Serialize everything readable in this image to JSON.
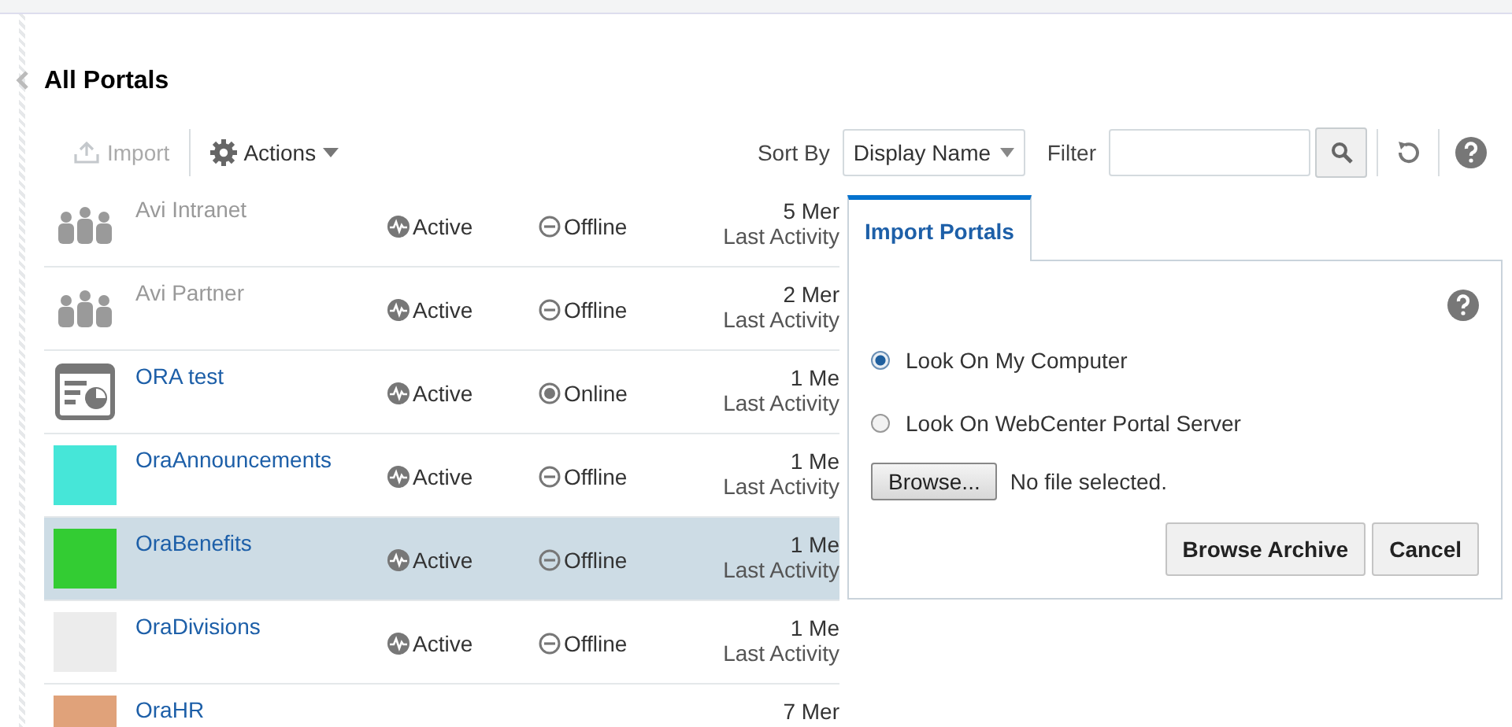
{
  "title": "All Portals",
  "toolbar": {
    "import_label": "Import",
    "import_disabled": true,
    "actions_label": "Actions",
    "sort_label": "Sort By",
    "sort_value": "Display Name",
    "filter_label": "Filter"
  },
  "portals": [
    {
      "name": "Avi Intranet",
      "thumb": {
        "kind": "people"
      },
      "disabled": true,
      "status": "Active",
      "availability": {
        "label": "Offline",
        "online": false
      },
      "date": "5 Mer",
      "activity": "Last Activity",
      "selected": false
    },
    {
      "name": "Avi Partner",
      "thumb": {
        "kind": "people"
      },
      "disabled": true,
      "status": "Active",
      "availability": {
        "label": "Offline",
        "online": false
      },
      "date": "2 Mer",
      "activity": "Last Activity",
      "selected": false
    },
    {
      "name": "ORA test",
      "thumb": {
        "kind": "page"
      },
      "disabled": false,
      "status": "Active",
      "availability": {
        "label": "Online",
        "online": true
      },
      "date": "1 Me",
      "activity": "Last Activity",
      "selected": false
    },
    {
      "name": "OraAnnouncements",
      "thumb": {
        "kind": "swatch",
        "color": "#46e6d8"
      },
      "disabled": false,
      "status": "Active",
      "availability": {
        "label": "Offline",
        "online": false
      },
      "date": "1 Me",
      "activity": "Last Activity",
      "selected": false
    },
    {
      "name": "OraBenefits",
      "thumb": {
        "kind": "swatch",
        "color": "#33cc33"
      },
      "disabled": false,
      "status": "Active",
      "availability": {
        "label": "Offline",
        "online": false
      },
      "date": "1 Me",
      "activity": "Last Activity",
      "selected": true
    },
    {
      "name": "OraDivisions",
      "thumb": {
        "kind": "swatch",
        "color": "#ececec"
      },
      "disabled": false,
      "status": "Active",
      "availability": {
        "label": "Offline",
        "online": false
      },
      "date": "1 Me",
      "activity": "Last Activity",
      "selected": false
    },
    {
      "name": "OraHR",
      "thumb": {
        "kind": "swatch",
        "color": "#e0a27a"
      },
      "disabled": false,
      "date": "7 Mer",
      "selected": false
    }
  ],
  "import_popup": {
    "tab": "Import Portals",
    "options": [
      {
        "label": "Look On My Computer",
        "selected": true
      },
      {
        "label": "Look On WebCenter Portal Server",
        "selected": false
      }
    ],
    "browse_button": "Browse...",
    "file_status": "No file selected.",
    "buttons": [
      "Browse Archive",
      "Cancel"
    ]
  }
}
